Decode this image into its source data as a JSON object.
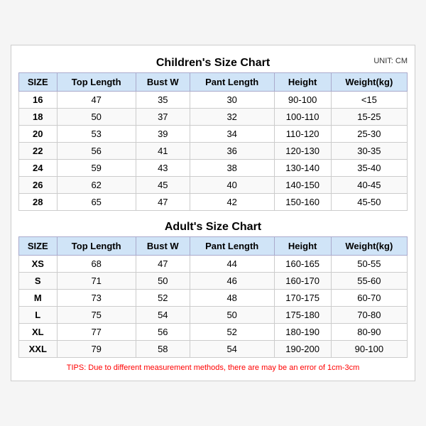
{
  "children_title": "Children's Size Chart",
  "adult_title": "Adult's Size Chart",
  "unit_label": "UNIT: CM",
  "tips": "TIPS: Due to different measurement methods, there are may be an error of 1cm-3cm",
  "headers": [
    "SIZE",
    "Top Length",
    "Bust W",
    "Pant Length",
    "Height",
    "Weight(kg)"
  ],
  "children_rows": [
    [
      "16",
      "47",
      "35",
      "30",
      "90-100",
      "<15"
    ],
    [
      "18",
      "50",
      "37",
      "32",
      "100-110",
      "15-25"
    ],
    [
      "20",
      "53",
      "39",
      "34",
      "110-120",
      "25-30"
    ],
    [
      "22",
      "56",
      "41",
      "36",
      "120-130",
      "30-35"
    ],
    [
      "24",
      "59",
      "43",
      "38",
      "130-140",
      "35-40"
    ],
    [
      "26",
      "62",
      "45",
      "40",
      "140-150",
      "40-45"
    ],
    [
      "28",
      "65",
      "47",
      "42",
      "150-160",
      "45-50"
    ]
  ],
  "adult_rows": [
    [
      "XS",
      "68",
      "47",
      "44",
      "160-165",
      "50-55"
    ],
    [
      "S",
      "71",
      "50",
      "46",
      "160-170",
      "55-60"
    ],
    [
      "M",
      "73",
      "52",
      "48",
      "170-175",
      "60-70"
    ],
    [
      "L",
      "75",
      "54",
      "50",
      "175-180",
      "70-80"
    ],
    [
      "XL",
      "77",
      "56",
      "52",
      "180-190",
      "80-90"
    ],
    [
      "XXL",
      "79",
      "58",
      "54",
      "190-200",
      "90-100"
    ]
  ]
}
